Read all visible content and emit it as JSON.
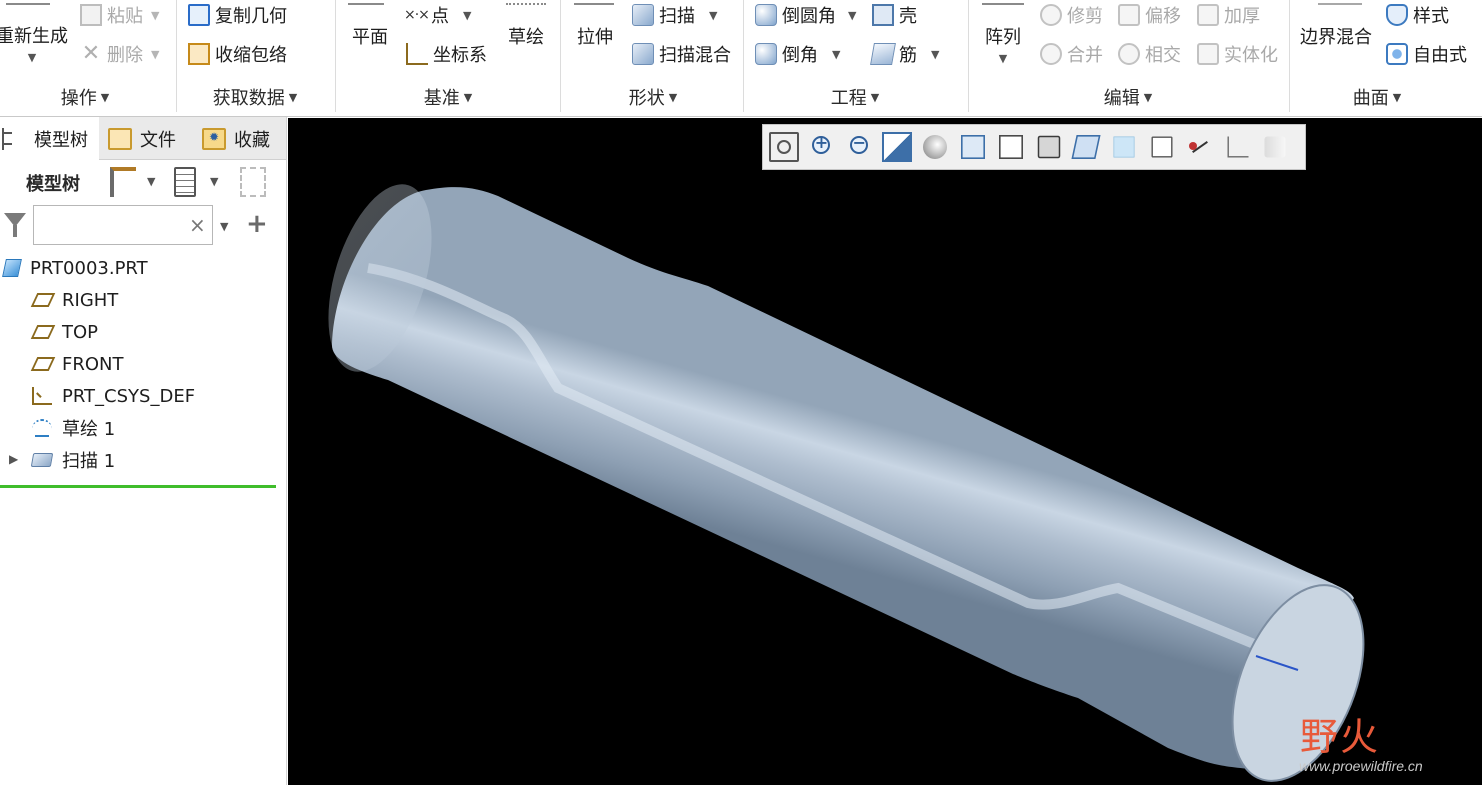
{
  "ribbon": {
    "groups": [
      {
        "label": "操作"
      },
      {
        "label": "获取数据"
      },
      {
        "label": "基准"
      },
      {
        "label": "形状"
      },
      {
        "label": "工程"
      },
      {
        "label": "编辑"
      },
      {
        "label": "曲面"
      }
    ],
    "operations": {
      "regenerate": "重新生成",
      "paste": "粘贴",
      "delete": "删除"
    },
    "get_data": {
      "copy_geometry": "复制几何",
      "shrinkwrap": "收缩包络"
    },
    "datum": {
      "plane": "平面",
      "point": "点",
      "csys": "坐标系",
      "sketch": "草绘"
    },
    "shapes": {
      "extrude": "拉伸",
      "sweep": "扫描",
      "swept_blend": "扫描混合"
    },
    "engineering": {
      "round": "倒圆角",
      "chamfer": "倒角",
      "shell": "壳",
      "rib": "筋"
    },
    "editing": {
      "pattern": "阵列",
      "trim": "修剪",
      "offset": "偏移",
      "thicken": "加厚",
      "merge": "合并",
      "intersect": "相交",
      "solidify": "实体化"
    },
    "surfaces": {
      "boundary_blend": "边界混合",
      "style": "样式",
      "freestyle": "自由式"
    }
  },
  "panel": {
    "tabs": [
      "模型树",
      "文件",
      "收藏"
    ],
    "tree_label": "模型树",
    "search": {
      "value": "",
      "placeholder": ""
    },
    "clear_symbol": "×",
    "add_symbol": "+",
    "nodes": [
      {
        "label": "PRT0003.PRT",
        "icon": "part-icon"
      },
      {
        "label": "RIGHT",
        "icon": "datum-plane-icon"
      },
      {
        "label": "TOP",
        "icon": "datum-plane-icon"
      },
      {
        "label": "FRONT",
        "icon": "datum-plane-icon"
      },
      {
        "label": "PRT_CSYS_DEF",
        "icon": "csys-icon"
      },
      {
        "label": "草绘 1",
        "icon": "sketch-icon"
      },
      {
        "label": "扫描 1",
        "icon": "sweep-icon"
      }
    ]
  },
  "viewport": {
    "background": "#000000",
    "model_color": "#a9b9cb",
    "toolbar_icons": [
      "zoom-fit-icon",
      "zoom-in-icon",
      "zoom-out-icon",
      "repaint-icon",
      "saved-orientations-icon",
      "saved-views-icon",
      "display-style-icon",
      "perspective-view-icon",
      "section-icon",
      "datum-display-icon",
      "annotation-display-icon",
      "spin-center-icon",
      "csys-display-icon",
      "appearance-icon"
    ],
    "active_toolbar_icon": "datum-display-icon"
  },
  "watermark": {
    "brand": "野火",
    "url": "www.proewildfire.cn"
  }
}
